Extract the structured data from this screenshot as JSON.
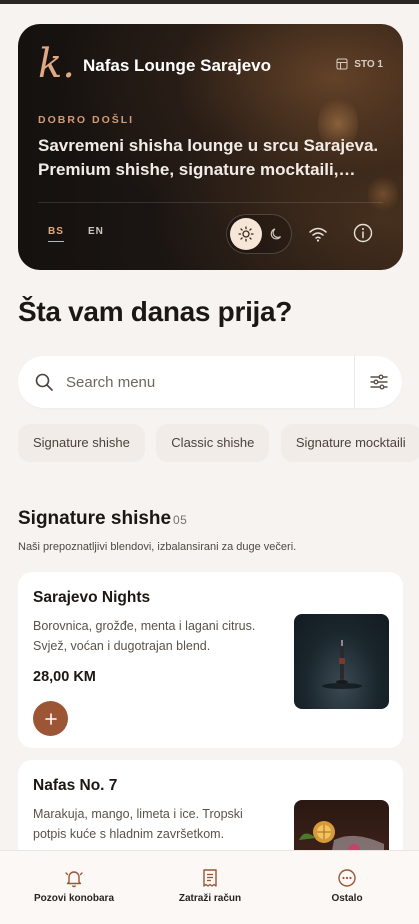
{
  "hero": {
    "logo": "k.",
    "venue_name": "Nafas Lounge Sarajevo",
    "table_label": "STO 1",
    "welcome": "DOBRO DOŠLI",
    "tagline": "Savremeni shisha lounge u srcu Sarajeva. Premium shishe, signature mocktaili, Rubinové dezerti i ugođaj bez žurbe.",
    "languages": [
      "BS",
      "EN"
    ],
    "active_language": "BS",
    "accent_color": "#e0a884"
  },
  "page_heading": "Šta vam danas prija?",
  "search": {
    "placeholder": "Search menu"
  },
  "chips": [
    "Signature shishe",
    "Classic shishe",
    "Signature mocktaili"
  ],
  "section": {
    "title": "Signature shishe",
    "count": "05",
    "description": "Naši prepoznatljivi blendovi, izbalansirani za duge večeri."
  },
  "items": [
    {
      "name": "Sarajevo Nights",
      "description": "Borovnica, grožđe, menta i lagani citrus. Svjež, voćan i dugotrajan blend.",
      "price": "28,00 KM"
    },
    {
      "name": "Nafas No. 7",
      "description": "Marakuja, mango, limeta i ice. Tropski potpis kuće s hladnim završetkom."
    }
  ],
  "tabs": [
    {
      "label": "Pozovi konobara",
      "icon": "bell-icon"
    },
    {
      "label": "Zatraži račun",
      "icon": "receipt-icon"
    },
    {
      "label": "Ostalo",
      "icon": "more-icon"
    }
  ],
  "colors": {
    "brand": "#9c5636",
    "background": "#f7f3f0"
  }
}
